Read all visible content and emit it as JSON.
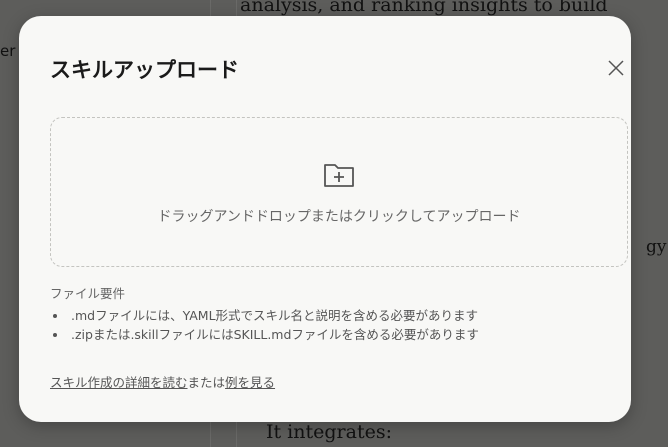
{
  "background": {
    "top_text": "analysis, and ranking insights to build actionable SEO",
    "left_text": "er",
    "right_text": "gy",
    "bottom_text": "It integrates:"
  },
  "modal": {
    "title": "スキルアップロード",
    "close_icon": "close-icon",
    "dropzone": {
      "icon": "folder-plus-icon",
      "text": "ドラッグアンドドロップまたはクリックしてアップロード"
    },
    "requirements_label": "ファイル要件",
    "requirements": [
      ".mdファイルには、YAML形式でスキル名と説明を含める必要があります",
      ".zipまたは.skillファイルにはSKILL.mdファイルを含める必要があります"
    ],
    "footer": {
      "link1": "スキル作成の詳細を読む",
      "middle": "または",
      "link2": "例を見る"
    }
  }
}
